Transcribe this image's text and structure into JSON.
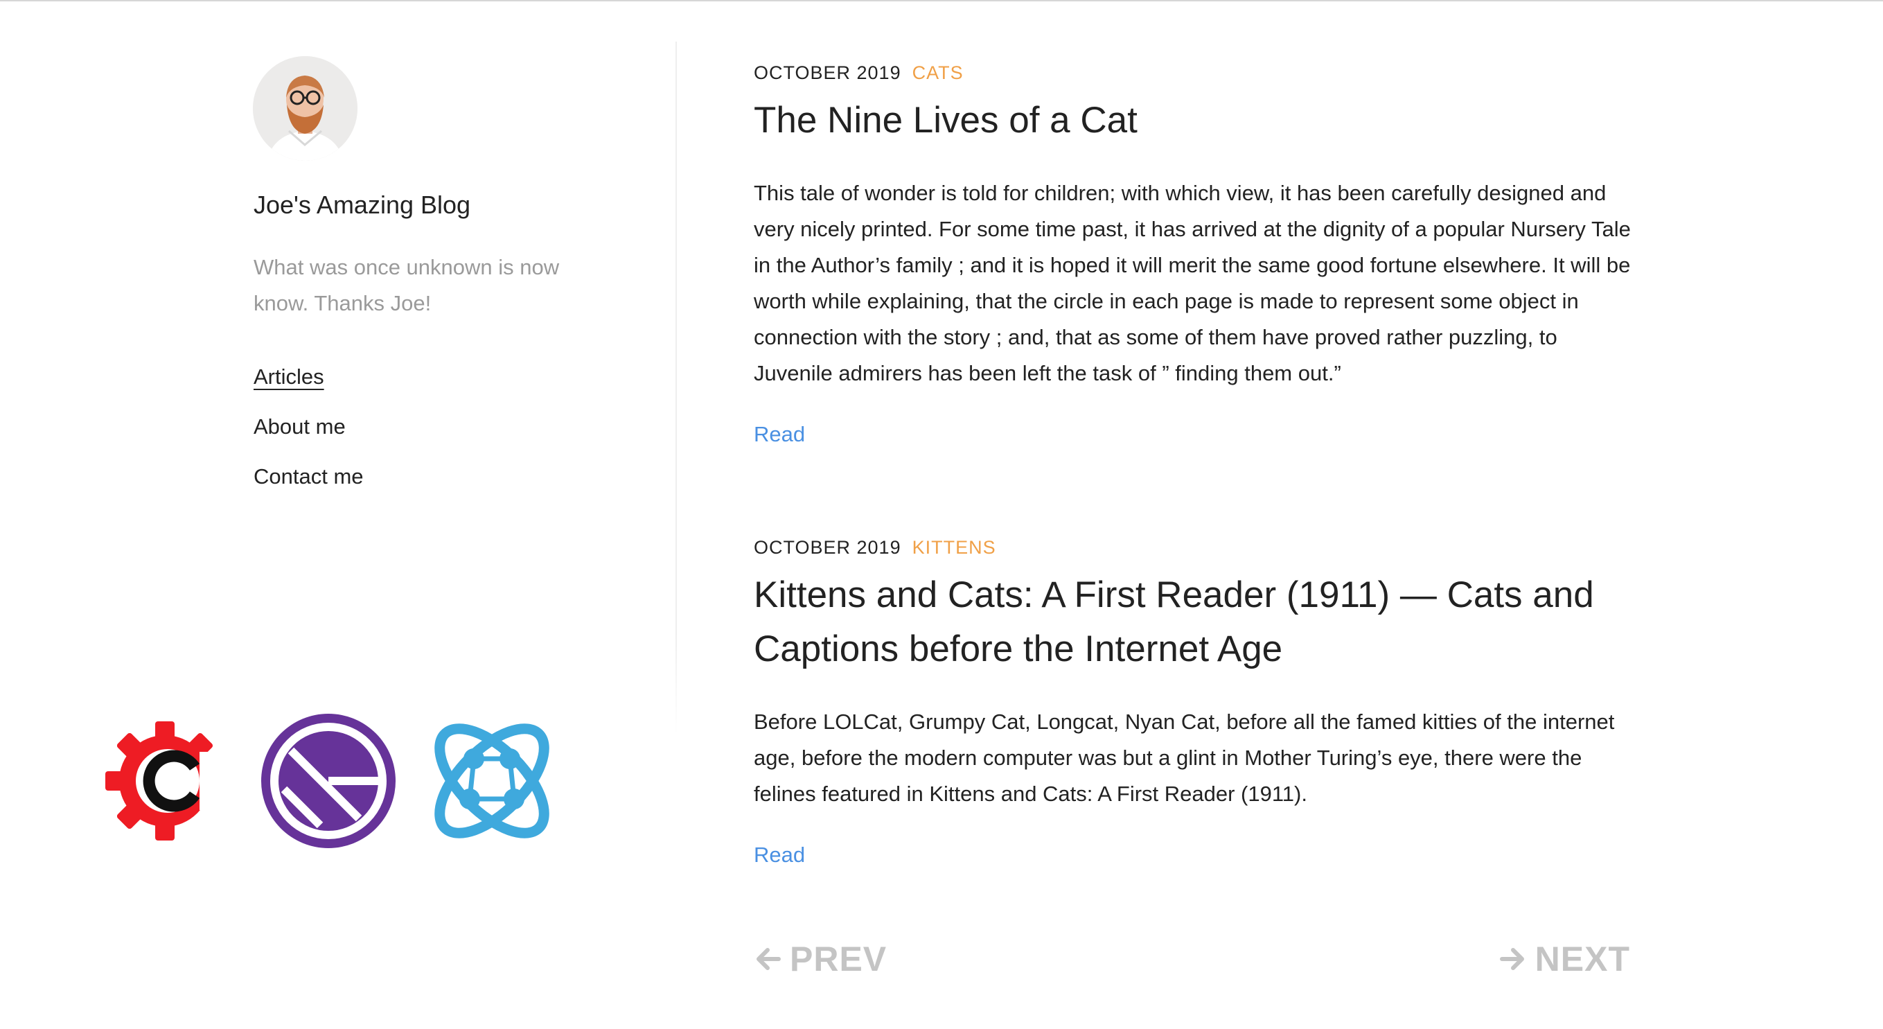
{
  "sidebar": {
    "blog_title": "Joe's Amazing Blog",
    "description": "What was once unknown is now know. Thanks Joe!",
    "nav": [
      {
        "label": "Articles",
        "active": true
      },
      {
        "label": "About me",
        "active": false
      },
      {
        "label": "Contact me",
        "active": false
      }
    ],
    "logos": [
      "contentful-logo",
      "gatsby-logo",
      "graphql-atom-logo"
    ]
  },
  "posts": [
    {
      "date": "OCTOBER 2019",
      "category": "CATS",
      "title": "The Nine Lives of a Cat",
      "excerpt": "This tale of wonder is told for children; with which view, it has been carefully designed and very nicely printed. For some time past, it has arrived at the dignity of a popular Nursery Tale in the Author’s family ; and it is hoped it will merit the same good fortune elsewhere. It will be worth while explaining, that the circle in each page is made to represent some object in connection with the story ; and, that as some of them have proved rather puzzling, to Juvenile admirers has been left the task of ” finding them out.”",
      "read_label": "Read"
    },
    {
      "date": "OCTOBER 2019",
      "category": "KITTENS",
      "title": "Kittens and Cats: A First Reader (1911) — Cats and Captions before the Internet Age",
      "excerpt": "Before LOLCat, Grumpy Cat, Longcat, Nyan Cat, before all the famed kitties of the internet age, before the modern computer was but a glint in Mother Turing’s eye, there were the felines featured in Kittens and Cats: A First Reader (1911).",
      "read_label": "Read"
    }
  ],
  "pagination": {
    "prev_label": "PREV",
    "next_label": "NEXT"
  },
  "colors": {
    "category": "#f0a047",
    "link": "#4a90e2",
    "pager": "#c4c4c4",
    "contentful_red": "#ee1c24",
    "gatsby_purple": "#663399",
    "atom_blue": "#3fa9dd"
  }
}
